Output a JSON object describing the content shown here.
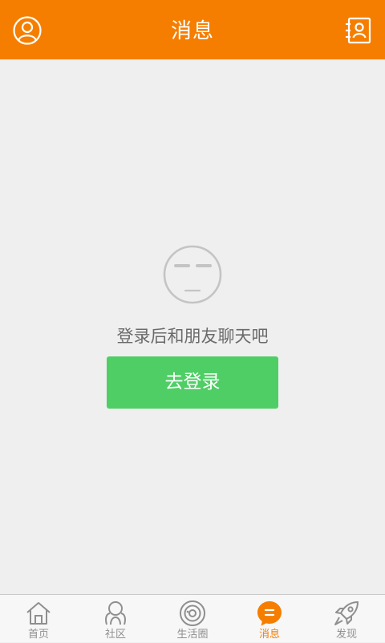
{
  "header": {
    "title": "消息",
    "left_icon": "user-profile-icon",
    "right_icon": "contacts-book-icon"
  },
  "empty_state": {
    "icon": "expressionless-face-icon",
    "message": "登录后和朋友聊天吧",
    "login_button_label": "去登录"
  },
  "tabbar": {
    "active_index": 3,
    "items": [
      {
        "label": "首页",
        "icon": "home-icon"
      },
      {
        "label": "社区",
        "icon": "community-icon"
      },
      {
        "label": "生活圈",
        "icon": "life-circle-icon"
      },
      {
        "label": "消息",
        "icon": "message-bubble-icon"
      },
      {
        "label": "发现",
        "icon": "rocket-icon"
      }
    ]
  },
  "colors": {
    "brand": "#f57e00",
    "background": "#efefef",
    "login_button": "#4fce65",
    "tab_inactive": "#8f8f8f"
  }
}
